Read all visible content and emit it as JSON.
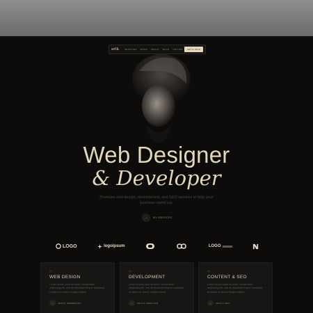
{
  "nav": {
    "logo": "arlk",
    "links": [
      "SERVICES",
      "WORK",
      "ABOUT",
      "BLOG",
      "PRICING"
    ],
    "cta": "LET'S TALK"
  },
  "hero": {
    "title": "Web Designer",
    "subtitle": "& Developer",
    "description": "Premium web design, development, and SEO services to help your business stand out.",
    "services_button": "MY SERVICES"
  },
  "logos": [
    {
      "icon": "logo-mark",
      "text": "LOGO"
    },
    {
      "icon": "logo-ipsum-mark",
      "text": "logoipsum"
    },
    {
      "icon": "shield-logo",
      "text": ""
    },
    {
      "icon": "infinity-logo",
      "text": ""
    },
    {
      "icon": "logo-text-mark",
      "text": "LOGO"
    },
    {
      "icon": "n-logo",
      "text": ""
    }
  ],
  "cards": [
    {
      "num": "01",
      "title": "WEB DESIGN",
      "body": "Lorem ipsum dolor sit amet, consectetur adipiscing elit, sed do eiusmod tempor incididunt ut labore et dolore magna aliqua.",
      "more": "ABOUT WEBDESIGN"
    },
    {
      "num": "02",
      "title": "DEVELOPMENT",
      "body": "Lorem ipsum dolor sit amet, consectetur adipiscing elit, sed do eiusmod tempor incididunt ut labore et dolore magna aliqua.",
      "more": "ABOUT WEBFLOW"
    },
    {
      "num": "03",
      "title": "CONTENT & SEO",
      "body": "Lorem ipsum dolor sit amet, consectetur adipiscing elit, sed do eiusmod tempor incididunt ut labore et dolore magna aliqua.",
      "more": "ABOUT SEO"
    }
  ],
  "colors": {
    "accent": "#e6d6bb",
    "background": "#0d0c0b",
    "card": "#171615"
  }
}
